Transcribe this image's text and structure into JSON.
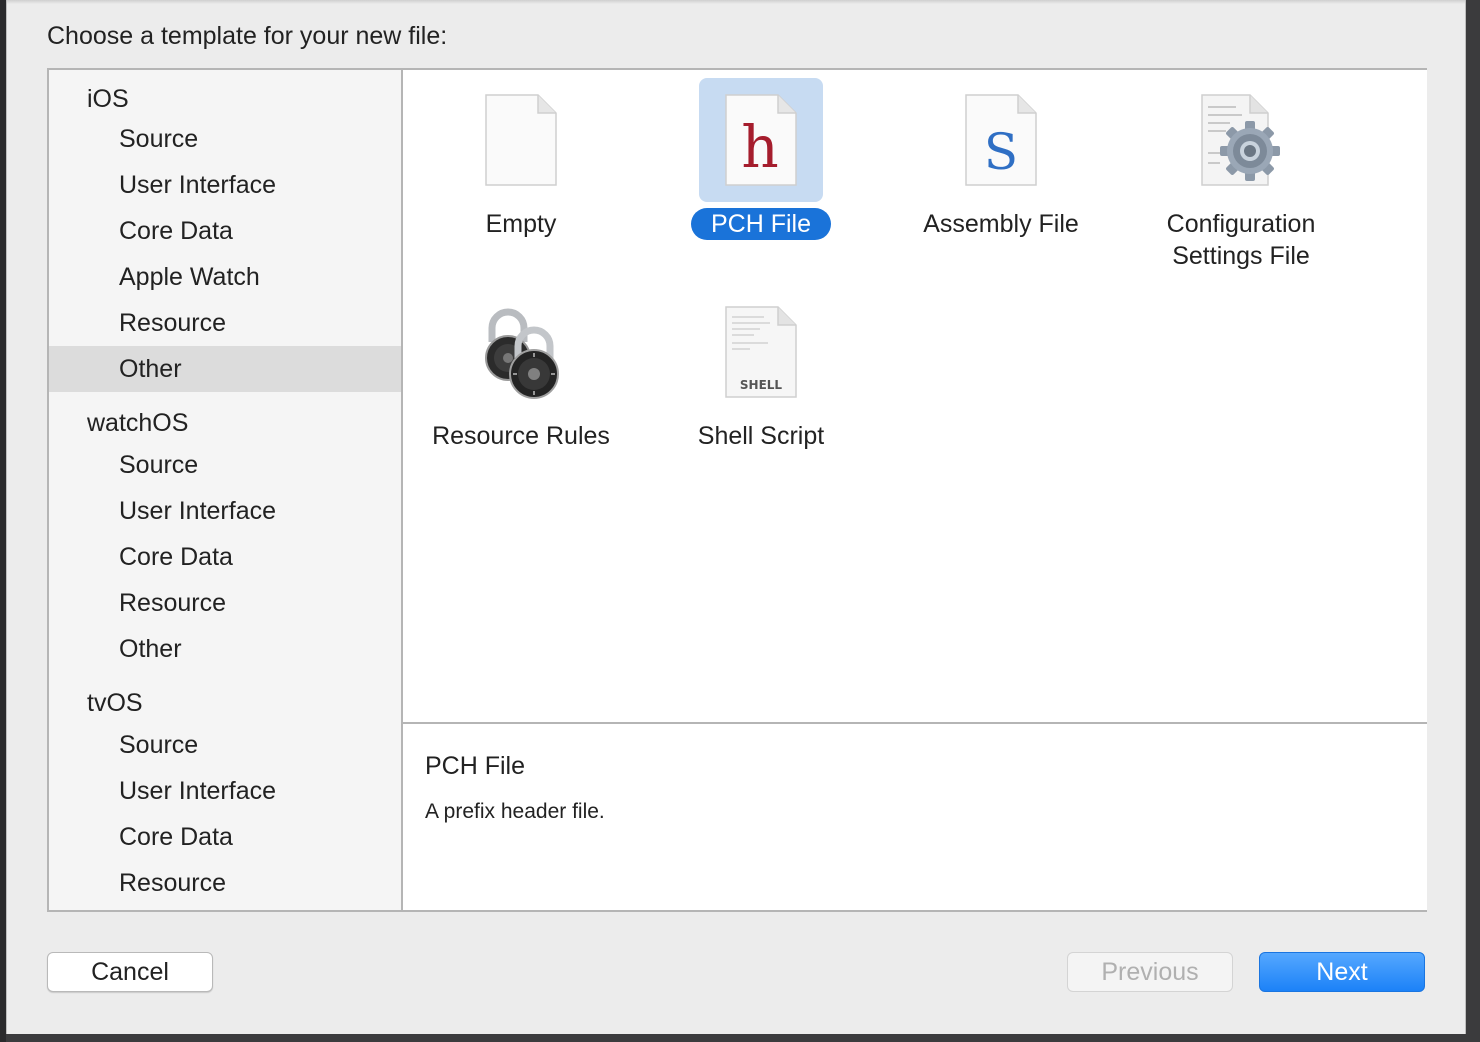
{
  "dialog": {
    "title": "Choose a template for your new file:"
  },
  "sidebar": {
    "groups": [
      {
        "title": "iOS",
        "items": [
          "Source",
          "User Interface",
          "Core Data",
          "Apple Watch",
          "Resource",
          "Other"
        ],
        "selected_index": 5
      },
      {
        "title": "watchOS",
        "items": [
          "Source",
          "User Interface",
          "Core Data",
          "Resource",
          "Other"
        ]
      },
      {
        "title": "tvOS",
        "items": [
          "Source",
          "User Interface",
          "Core Data",
          "Resource"
        ]
      }
    ]
  },
  "templates": [
    {
      "label": "Empty",
      "icon": "blank-document-icon",
      "selected": false
    },
    {
      "label": "PCH File",
      "icon": "header-h-document-icon",
      "icon_letter": "h",
      "selected": true
    },
    {
      "label": "Assembly File",
      "icon": "assembly-s-document-icon",
      "icon_letter": "S",
      "selected": false
    },
    {
      "label": "Configuration\nSettings File",
      "icon": "config-gear-document-icon",
      "selected": false
    },
    {
      "label": "Resource Rules",
      "icon": "padlocks-icon",
      "selected": false
    },
    {
      "label": "Shell Script",
      "icon": "shell-document-icon",
      "icon_text": "SHELL",
      "selected": false
    }
  ],
  "details": {
    "title": "PCH File",
    "description": "A prefix header file."
  },
  "buttons": {
    "cancel": "Cancel",
    "previous": "Previous",
    "next": "Next"
  },
  "colors": {
    "selection_blue": "#1a73d9",
    "icon_selection_bg": "#c7dbf2",
    "header_letter": "#a51d2d",
    "assembly_letter": "#2f6fc4"
  }
}
